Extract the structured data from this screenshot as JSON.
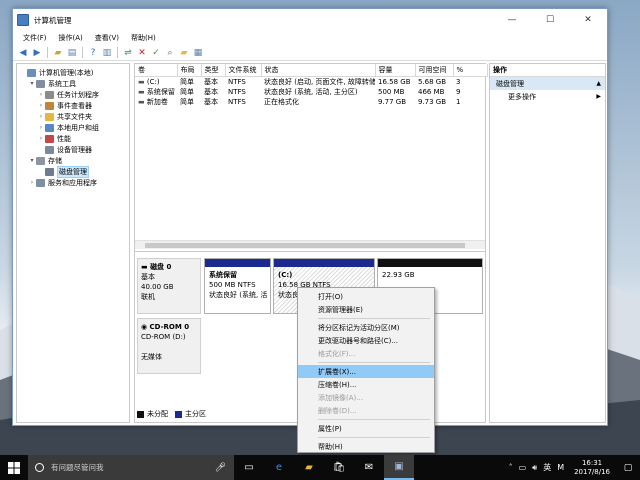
{
  "window": {
    "title": "计算机管理",
    "controls": {
      "minimize": "—",
      "maximize": "☐",
      "close": "✕"
    }
  },
  "menubar": [
    "文件(F)",
    "操作(A)",
    "查看(V)",
    "帮助(H)"
  ],
  "tree": [
    {
      "label": "计算机管理(本地)",
      "indent": 0,
      "toggle": "",
      "icon": "computer-icon",
      "color": "#6a8fb8"
    },
    {
      "label": "系统工具",
      "indent": 1,
      "toggle": "▾",
      "icon": "tools-icon",
      "color": "#7f8fa0"
    },
    {
      "label": "任务计划程序",
      "indent": 2,
      "toggle": "›",
      "icon": "task-scheduler-icon",
      "color": "#8c8c8c"
    },
    {
      "label": "事件查看器",
      "indent": 2,
      "toggle": "›",
      "icon": "event-viewer-icon",
      "color": "#c0853a"
    },
    {
      "label": "共享文件夹",
      "indent": 2,
      "toggle": "›",
      "icon": "shared-folder-icon",
      "color": "#e6b73f"
    },
    {
      "label": "本地用户和组",
      "indent": 2,
      "toggle": "›",
      "icon": "users-icon",
      "color": "#5a87c4"
    },
    {
      "label": "性能",
      "indent": 2,
      "toggle": "›",
      "icon": "performance-icon",
      "color": "#c24848"
    },
    {
      "label": "设备管理器",
      "indent": 2,
      "toggle": "",
      "icon": "device-manager-icon",
      "color": "#7a8a9c"
    },
    {
      "label": "存储",
      "indent": 1,
      "toggle": "▾",
      "icon": "storage-icon",
      "color": "#8c96a0"
    },
    {
      "label": "磁盘管理",
      "indent": 2,
      "toggle": "",
      "icon": "disk-management-icon",
      "color": "#6b7d8f",
      "selected": true
    },
    {
      "label": "服务和应用程序",
      "indent": 1,
      "toggle": "›",
      "icon": "services-icon",
      "color": "#7f8fa0"
    }
  ],
  "volumes": {
    "headers": [
      "卷",
      "布局",
      "类型",
      "文件系统",
      "状态",
      "容量",
      "可用空间",
      "%"
    ],
    "rows": [
      [
        "(C:)",
        "简单",
        "基本",
        "NTFS",
        "状态良好 (启动, 页面文件, 故障转储, 主分区)",
        "16.58 GB",
        "5.68 GB",
        "3"
      ],
      [
        "系统保留",
        "简单",
        "基本",
        "NTFS",
        "状态良好 (系统, 活动, 主分区)",
        "500 MB",
        "466 MB",
        "9"
      ],
      [
        "新加卷",
        "简单",
        "基本",
        "NTFS",
        "正在格式化",
        "9.77 GB",
        "9.73 GB",
        "1"
      ]
    ]
  },
  "disks": [
    {
      "name": "磁盘 0",
      "type": "基本",
      "size": "40.00 GB",
      "status": "联机",
      "partitions": [
        {
          "name": "系统保留",
          "detail": "500 MB NTFS",
          "status": "状态良好 (系统, 活",
          "color": "#1c2a8f",
          "hatched": false
        },
        {
          "name": "(C:)",
          "detail": "16.58 GB NTFS",
          "status": "状态良好 (启动, 页",
          "color": "#1c2a8f",
          "hatched": true
        },
        {
          "name": "",
          "detail": "22.93 GB",
          "status": "",
          "color": "#111111",
          "hatched": false
        }
      ]
    },
    {
      "name": "CD-ROM 0",
      "type": "CD-ROM (D:)",
      "size": "",
      "status": "无媒体",
      "partitions": []
    }
  ],
  "legend": [
    {
      "label": "未分配",
      "color": "#111111"
    },
    {
      "label": "主分区",
      "color": "#1c2a8f"
    }
  ],
  "actions": {
    "header": "操作",
    "section": "磁盘管理",
    "more": "更多操作"
  },
  "context_menu": [
    {
      "label": "打开(O)",
      "disabled": false
    },
    {
      "label": "资源管理器(E)",
      "disabled": false
    },
    {
      "sep": true
    },
    {
      "label": "将分区标记为活动分区(M)",
      "disabled": false
    },
    {
      "label": "更改驱动器号和路径(C)...",
      "disabled": false
    },
    {
      "label": "格式化(F)...",
      "disabled": true
    },
    {
      "sep": true
    },
    {
      "label": "扩展卷(X)...",
      "disabled": false,
      "highlight": true
    },
    {
      "label": "压缩卷(H)...",
      "disabled": false
    },
    {
      "label": "添加镜像(A)...",
      "disabled": true
    },
    {
      "label": "删除卷(D)...",
      "disabled": true
    },
    {
      "sep": true
    },
    {
      "label": "属性(P)",
      "disabled": false
    },
    {
      "sep": true
    },
    {
      "label": "帮助(H)",
      "disabled": false
    }
  ],
  "taskbar": {
    "search_placeholder": "有问题尽管问我",
    "ime": "英",
    "ime2": "M",
    "time": "16:31",
    "date": "2017/8/16"
  },
  "colors": {
    "primary_partition": "#1c2a8f",
    "unallocated": "#111111",
    "selection": "#91c9f7"
  }
}
